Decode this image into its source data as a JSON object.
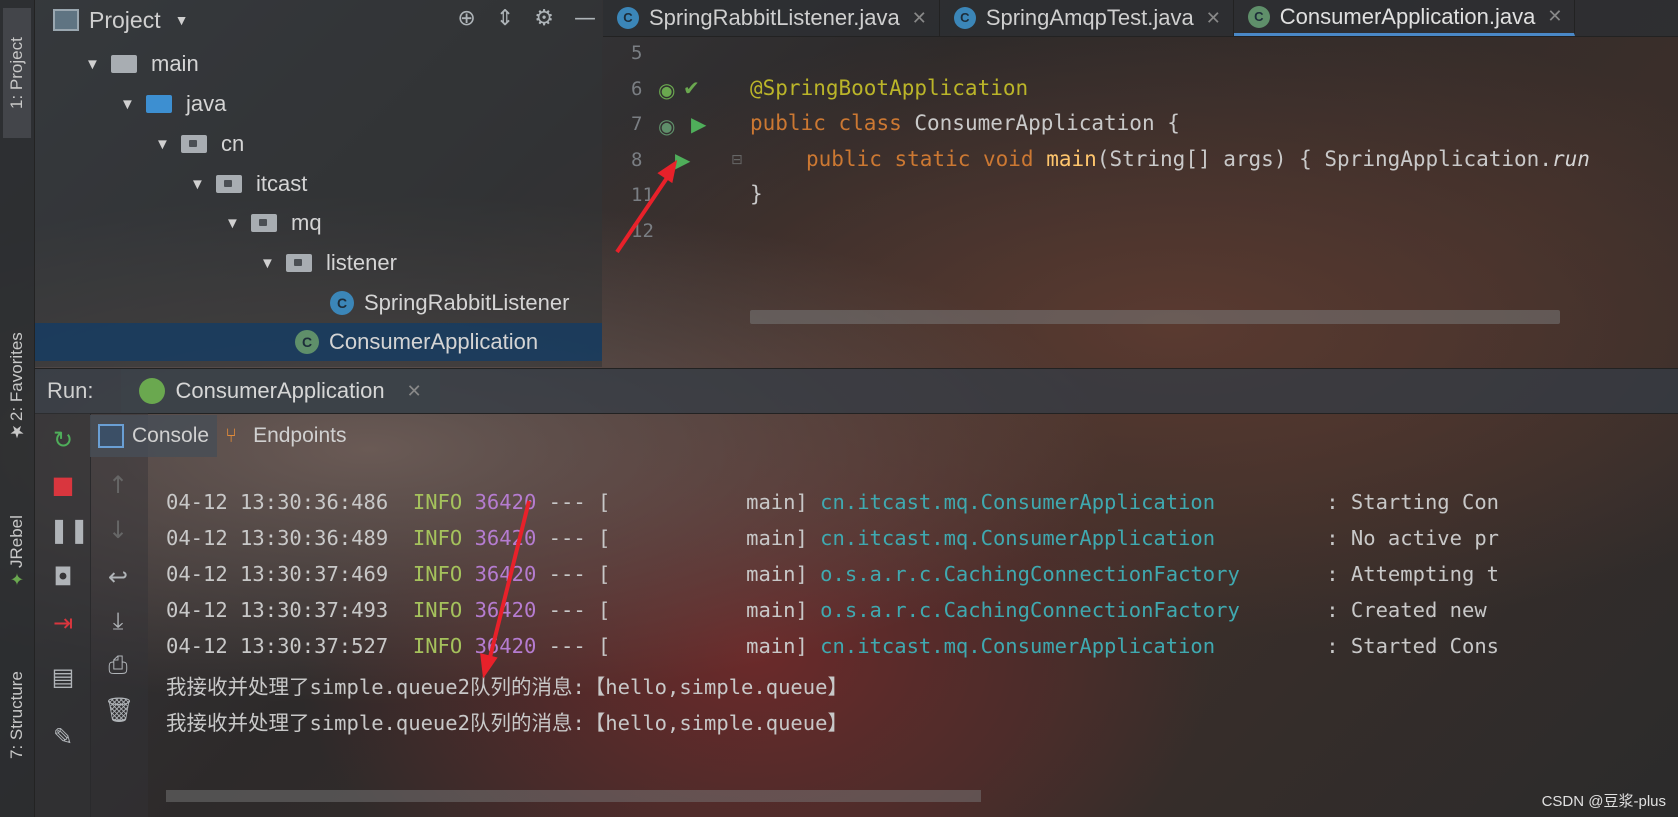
{
  "tool_strip": {
    "tabs": [
      {
        "label": "1: Project"
      },
      {
        "label": "2: Favorites"
      },
      {
        "label": "JRebel"
      },
      {
        "label": "7: Structure"
      }
    ]
  },
  "project_panel": {
    "title": "Project",
    "tree": [
      {
        "label": "main",
        "kind": "folder"
      },
      {
        "label": "java",
        "kind": "source-folder"
      },
      {
        "label": "cn",
        "kind": "package"
      },
      {
        "label": "itcast",
        "kind": "package"
      },
      {
        "label": "mq",
        "kind": "package"
      },
      {
        "label": "listener",
        "kind": "package"
      },
      {
        "label": "SpringRabbitListener",
        "kind": "class"
      },
      {
        "label": "ConsumerApplication",
        "kind": "spring-class",
        "selected": true
      }
    ]
  },
  "editor": {
    "tabs": [
      {
        "label": "SpringRabbitListener.java",
        "active": false
      },
      {
        "label": "SpringAmqpTest.java",
        "active": false
      },
      {
        "label": "ConsumerApplication.java",
        "active": true
      }
    ],
    "line_numbers": [
      "5",
      "6",
      "7",
      "8",
      "11",
      "12"
    ],
    "code": {
      "l6_annotation": "@SpringBootApplication",
      "l7_kw1": "public",
      "l7_kw2": "class",
      "l7_rest": " ConsumerApplication {",
      "l8_kw": "public static void",
      "l8_fn": "main",
      "l8_args": "(String[] args) { SpringApplication.",
      "l8_run": "run",
      "l11": "}"
    }
  },
  "run_panel": {
    "label": "Run:",
    "config_name": "ConsumerApplication",
    "tabs": [
      {
        "label": "Console",
        "active": true
      },
      {
        "label": "Endpoints",
        "active": false
      }
    ],
    "log_lines": [
      {
        "time": "04-12 13:30:36:486",
        "level": "INFO",
        "pid": "36420",
        "thread": "--- [           main]",
        "logger": "cn.itcast.mq.ConsumerApplication",
        "msg": ": Starting Con"
      },
      {
        "time": "04-12 13:30:36:489",
        "level": "INFO",
        "pid": "36420",
        "thread": "--- [           main]",
        "logger": "cn.itcast.mq.ConsumerApplication",
        "msg": ": No active pr"
      },
      {
        "time": "04-12 13:30:37:469",
        "level": "INFO",
        "pid": "36420",
        "thread": "--- [           main]",
        "logger": "o.s.a.r.c.CachingConnectionFactory",
        "msg": ": Attempting t"
      },
      {
        "time": "04-12 13:30:37:493",
        "level": "INFO",
        "pid": "36420",
        "thread": "--- [           main]",
        "logger": "o.s.a.r.c.CachingConnectionFactory",
        "msg": ": Created new "
      },
      {
        "time": "04-12 13:30:37:527",
        "level": "INFO",
        "pid": "36420",
        "thread": "--- [           main]",
        "logger": "cn.itcast.mq.ConsumerApplication",
        "msg": ": Started Cons"
      }
    ],
    "messages": [
      "我接收并处理了simple.queue2队列的消息:【hello,simple.queue】",
      "我接收并处理了simple.queue2队列的消息:【hello,simple.queue】"
    ]
  },
  "watermark": "CSDN @豆浆-plus",
  "colors": {
    "accent": "#4a88c7",
    "arrow": "#e8212a",
    "info": "#a5c25c",
    "pid": "#b57cd0",
    "logger": "#3fa9b0"
  }
}
